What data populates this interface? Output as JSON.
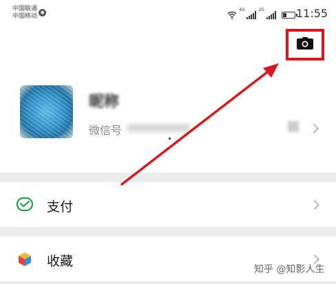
{
  "status_bar": {
    "carrier_line1": "中国联通",
    "carrier_line2": "中国移动",
    "network_1": "4G",
    "network_2": "2G",
    "time": "11:55",
    "battery_level": 0.35
  },
  "profile": {
    "nickname": "昵称",
    "wechat_id_label": "微信号"
  },
  "menu": {
    "items": [
      {
        "label": "支付",
        "icon": "wechat-pay-icon"
      },
      {
        "label": "收藏",
        "icon": "favorites-cube-icon"
      }
    ]
  },
  "annotation": {
    "highlight_color": "#e0141c",
    "arrow_color": "#d41a1f"
  },
  "watermark": "知乎 @知影人生"
}
